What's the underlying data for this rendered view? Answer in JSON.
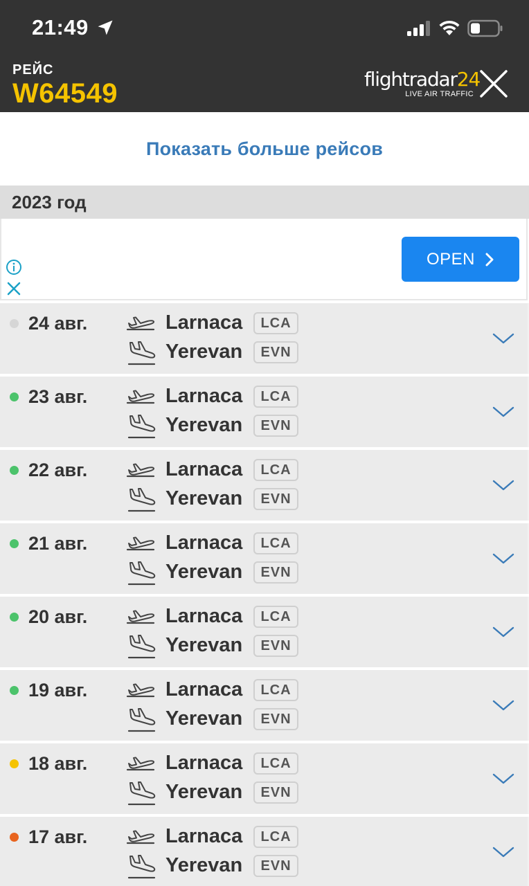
{
  "status_bar": {
    "time": "21:49"
  },
  "header": {
    "label": "РЕЙС",
    "flight_number": "W64549",
    "brand_name": "flightradar",
    "brand_num": "24",
    "brand_tagline": "LIVE AIR TRAFFIC"
  },
  "more_flights": {
    "label": "Показать больше рейсов"
  },
  "year_section": {
    "label": "2023 год"
  },
  "ad": {
    "open_label": "OPEN"
  },
  "colors": {
    "header_bg": "#333333",
    "accent_yellow": "#f5c300",
    "link_blue": "#3a7bb8",
    "ad_button": "#1a86f0",
    "status_gray": "#d6d6d6",
    "status_green": "#4cc36b",
    "status_yellow": "#f5c300",
    "status_orange": "#e8641e"
  },
  "flights": [
    {
      "date": "24 авг.",
      "status_color": "#d6d6d6",
      "dep_city": "Larnaca",
      "dep_code": "LCA",
      "arr_city": "Yerevan",
      "arr_code": "EVN"
    },
    {
      "date": "23 авг.",
      "status_color": "#4cc36b",
      "dep_city": "Larnaca",
      "dep_code": "LCA",
      "arr_city": "Yerevan",
      "arr_code": "EVN"
    },
    {
      "date": "22 авг.",
      "status_color": "#4cc36b",
      "dep_city": "Larnaca",
      "dep_code": "LCA",
      "arr_city": "Yerevan",
      "arr_code": "EVN"
    },
    {
      "date": "21 авг.",
      "status_color": "#4cc36b",
      "dep_city": "Larnaca",
      "dep_code": "LCA",
      "arr_city": "Yerevan",
      "arr_code": "EVN"
    },
    {
      "date": "20 авг.",
      "status_color": "#4cc36b",
      "dep_city": "Larnaca",
      "dep_code": "LCA",
      "arr_city": "Yerevan",
      "arr_code": "EVN"
    },
    {
      "date": "19 авг.",
      "status_color": "#4cc36b",
      "dep_city": "Larnaca",
      "dep_code": "LCA",
      "arr_city": "Yerevan",
      "arr_code": "EVN"
    },
    {
      "date": "18 авг.",
      "status_color": "#f5c300",
      "dep_city": "Larnaca",
      "dep_code": "LCA",
      "arr_city": "Yerevan",
      "arr_code": "EVN"
    },
    {
      "date": "17 авг.",
      "status_color": "#e8641e",
      "dep_city": "Larnaca",
      "dep_code": "LCA",
      "arr_city": "Yerevan",
      "arr_code": "EVN"
    }
  ]
}
